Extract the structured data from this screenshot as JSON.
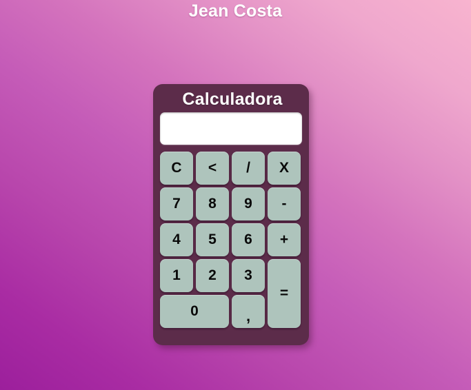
{
  "page": {
    "author_title": "Jean Costa",
    "background_from": "#9c1f9c",
    "background_to": "#f8b4cf"
  },
  "calculator": {
    "title": "Calculadora",
    "body_color": "#5c2c4a",
    "key_color": "#aec4bc",
    "display": {
      "value": "",
      "placeholder": ""
    },
    "keys": [
      {
        "label": "C",
        "name": "key-clear",
        "role": "clear"
      },
      {
        "label": "<",
        "name": "key-backspace",
        "role": "backspace"
      },
      {
        "label": "/",
        "name": "key-divide",
        "role": "operator"
      },
      {
        "label": "X",
        "name": "key-multiply",
        "role": "operator"
      },
      {
        "label": "7",
        "name": "key-7",
        "role": "digit"
      },
      {
        "label": "8",
        "name": "key-8",
        "role": "digit"
      },
      {
        "label": "9",
        "name": "key-9",
        "role": "digit"
      },
      {
        "label": "-",
        "name": "key-subtract",
        "role": "operator"
      },
      {
        "label": "4",
        "name": "key-4",
        "role": "digit"
      },
      {
        "label": "5",
        "name": "key-5",
        "role": "digit"
      },
      {
        "label": "6",
        "name": "key-6",
        "role": "digit"
      },
      {
        "label": "+",
        "name": "key-add",
        "role": "operator"
      },
      {
        "label": "1",
        "name": "key-1",
        "role": "digit"
      },
      {
        "label": "2",
        "name": "key-2",
        "role": "digit"
      },
      {
        "label": "3",
        "name": "key-3",
        "role": "digit"
      },
      {
        "label": "=",
        "name": "key-equals",
        "role": "equals"
      },
      {
        "label": "0",
        "name": "key-0",
        "role": "digit"
      },
      {
        "label": ",",
        "name": "key-decimal-comma",
        "role": "decimal"
      }
    ]
  }
}
